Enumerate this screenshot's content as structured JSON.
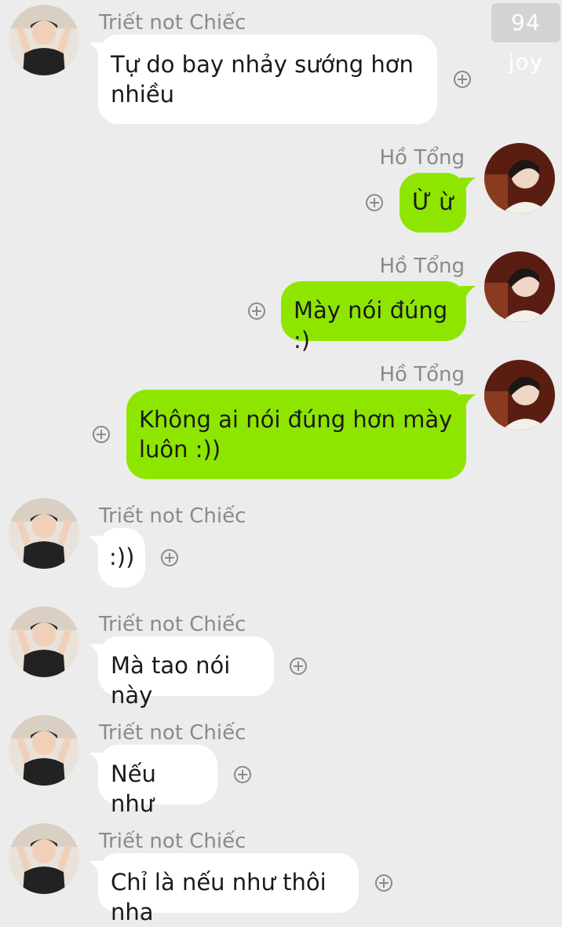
{
  "watermark": "94 joy",
  "messages": [
    {
      "sender": "Triết not Chiếc",
      "side": "left",
      "text": "Tự do bay nhảy sướng hơn nhiều"
    },
    {
      "sender": "Hồ Tổng",
      "side": "right",
      "text": "Ừ ừ"
    },
    {
      "sender": "Hồ Tổng",
      "side": "right",
      "text": "Mày nói đúng :)"
    },
    {
      "sender": "Hồ Tổng",
      "side": "right",
      "text": "Không ai nói đúng hơn mày luôn :))"
    },
    {
      "sender": "Triết not Chiếc",
      "side": "left",
      "text": ":))"
    },
    {
      "sender": "Triết not Chiếc",
      "side": "left",
      "text": "Mà tao nói này"
    },
    {
      "sender": "Triết not Chiếc",
      "side": "left",
      "text": "Nếu như"
    },
    {
      "sender": "Triết not Chiếc",
      "side": "left",
      "text": "Chỉ là nếu như thôi nha"
    }
  ],
  "colors": {
    "background": "#ececec",
    "sent_bubble": "#8ee600",
    "received_bubble": "#ffffff",
    "name_text": "#8a8a8a"
  },
  "icons": {
    "add_reaction": "plus-circle-icon"
  }
}
